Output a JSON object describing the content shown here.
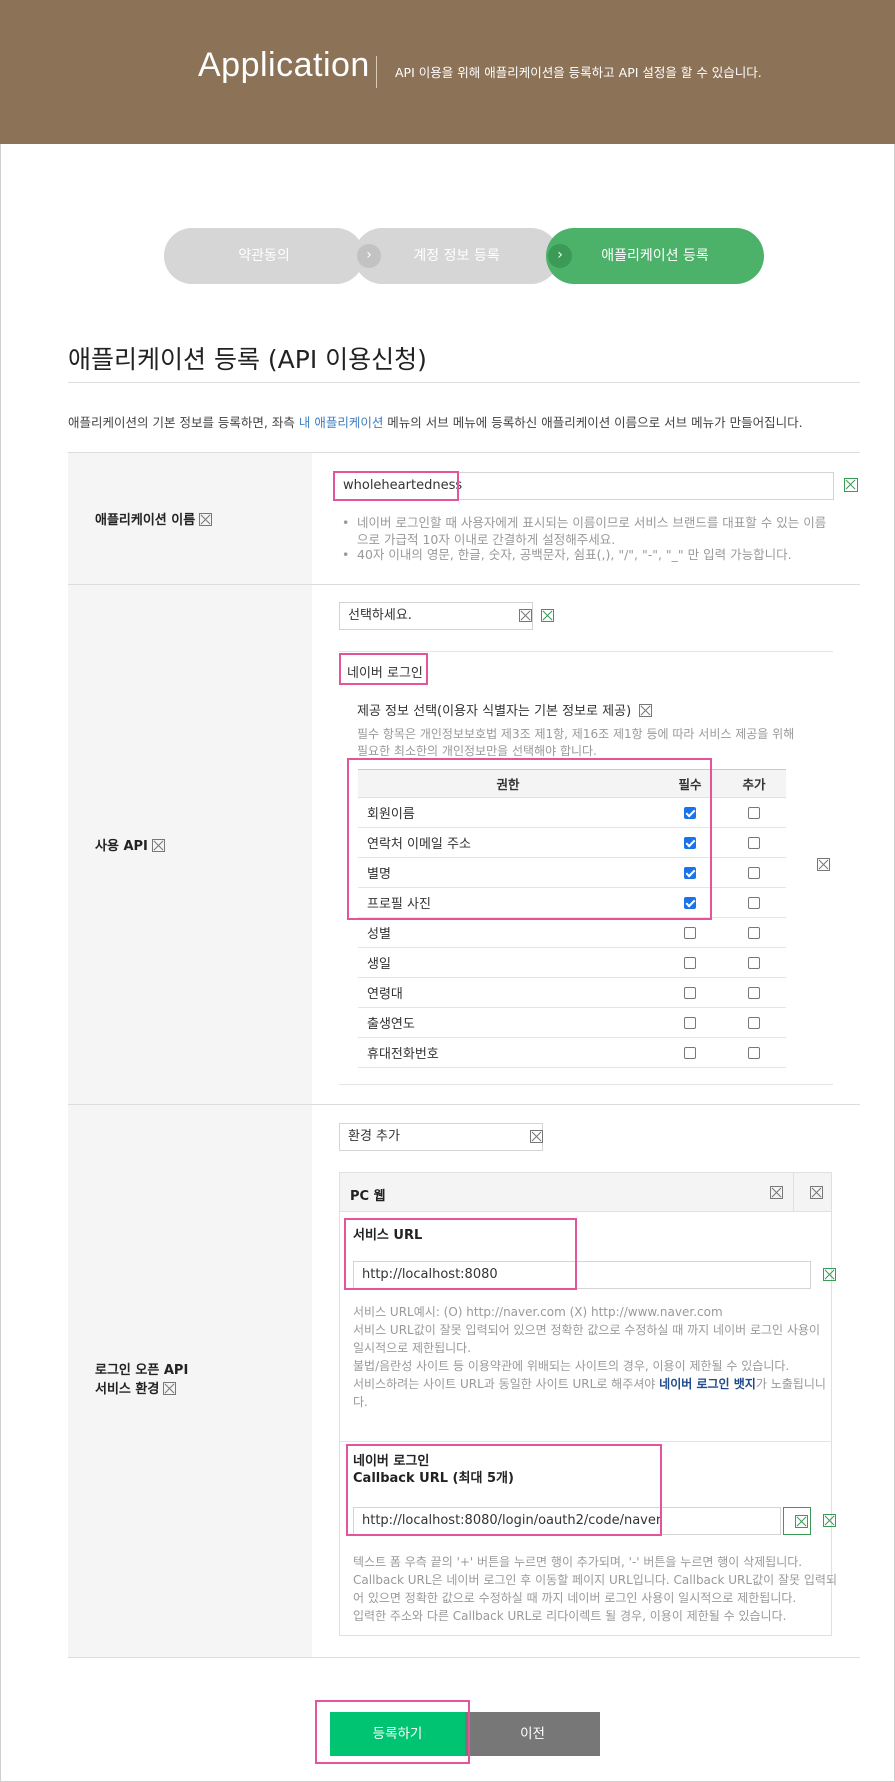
{
  "header": {
    "title": "Application",
    "description": "API 이용을 위해 애플리케이션을 등록하고 API 설정을 할 수 있습니다."
  },
  "steps": [
    {
      "label": "약관동의",
      "active": false
    },
    {
      "label": "계정 정보 등록",
      "active": false
    },
    {
      "label": "애플리케이션 등록",
      "active": true
    }
  ],
  "step_arrow": "›",
  "section": {
    "title": "애플리케이션 등록 (API 이용신청)",
    "desc_before": "애플리케이션의 기본 정보를 등록하면, 좌측 ",
    "desc_link": "내 애플리케이션",
    "desc_after": " 메뉴의 서브 메뉴에 등록하신 애플리케이션 이름으로 서브 메뉴가 만들어집니다."
  },
  "app_name": {
    "label": "애플리케이션 이름",
    "value": "wholeheartedness",
    "hint1_line1": "네이버 로그인할 때 사용자에게 표시되는 이름이므로 서비스 브랜드를 대표할 수 있는 이름",
    "hint1_line2": "으로 가급적 10자 이내로 간결하게 설정해주세요.",
    "hint2": "40자 이내의 영문, 한글, 숫자, 공백문자, 쉼표(,), \"/\", \"-\", \"_\" 만 입력 가능합니다."
  },
  "api": {
    "label": "사용 API",
    "select_placeholder": "선택하세요.",
    "selected_api": "네이버 로그인",
    "info_title": "제공 정보 선택(이용자 식별자는 기본 정보로 제공)",
    "info_desc_line1": "필수 항목은 개인정보보호법 제3조 제1항, 제16조 제1항 등에 따라 서비스 제공을 위해",
    "info_desc_line2": "필요한 최소한의 개인정보만을 선택해야 합니다.",
    "table_headers": [
      "권한",
      "필수",
      "추가"
    ],
    "permissions": [
      {
        "name": "회원이름",
        "required": true,
        "optional": false
      },
      {
        "name": "연락처 이메일 주소",
        "required": true,
        "optional": false
      },
      {
        "name": "별명",
        "required": true,
        "optional": false
      },
      {
        "name": "프로필 사진",
        "required": true,
        "optional": false
      },
      {
        "name": "성별",
        "required": false,
        "optional": false
      },
      {
        "name": "생일",
        "required": false,
        "optional": false
      },
      {
        "name": "연령대",
        "required": false,
        "optional": false
      },
      {
        "name": "출생연도",
        "required": false,
        "optional": false
      },
      {
        "name": "휴대전화번호",
        "required": false,
        "optional": false
      }
    ]
  },
  "env": {
    "label_line1": "로그인 오픈 API",
    "label_line2": "서비스 환경",
    "add_env": "환경 추가",
    "pc_web": "PC 웹",
    "service_url_label": "서비스 URL",
    "service_url": "http://localhost:8080",
    "service_hint_1": "서비스 URL예시: (O) http://naver.com (X) http://www.naver.com",
    "service_hint_2": "서비스 URL값이 잘못 입력되어 있으면 정확한 값으로 수정하실 때 까지 네이버 로그인 사용이",
    "service_hint_3": "일시적으로 제한됩니다.",
    "service_hint_4": "불법/음란성 사이트 등 이용약관에 위배되는 사이트의 경우, 이용이 제한될 수 있습니다.",
    "service_hint_5_before": "서비스하려는 사이트 URL과 동일한 사이트 URL로 해주셔야 ",
    "service_hint_5_bold": "네이버 로그인 뱃지",
    "service_hint_5_after": "가 노출됩니니",
    "service_hint_6": "다.",
    "callback_label_1": "네이버 로그인",
    "callback_label_2": "Callback URL (최대 5개)",
    "callback_url": "http://localhost:8080/login/oauth2/code/naver",
    "callback_hint_1": "텍스트 폼 우측 끝의 '+' 버튼을 누르면 행이 추가되며, '-' 버튼을 누르면 행이 삭제됩니다.",
    "callback_hint_2": "Callback URL은 네이버 로그인 후 이동할 페이지 URL입니다. Callback URL값이 잘못 입력되",
    "callback_hint_3": "어 있으면 정확한 값으로 수정하실 때 까지 네이버 로그인 사용이 일시적으로 제한됩니다.",
    "callback_hint_4": "입력한 주소와 다른 Callback URL로 리다이렉트 될 경우, 이용이 제한될 수 있습니다."
  },
  "buttons": {
    "register": "등록하기",
    "previous": "이전"
  },
  "colors": {
    "banner": "#8c7257",
    "active_step": "#4cb26a",
    "register_button": "#00c471",
    "highlight": "#e4549b",
    "link": "#3e7dbf"
  }
}
